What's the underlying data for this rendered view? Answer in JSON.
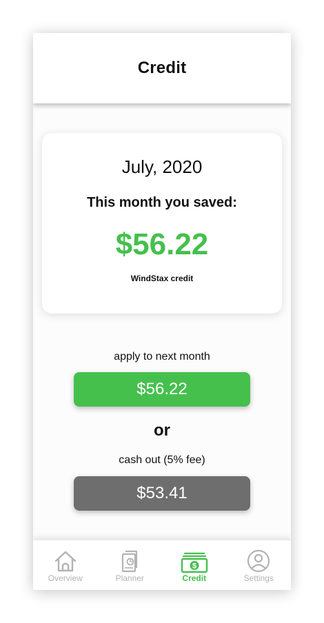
{
  "header": {
    "title": "Credit"
  },
  "summary": {
    "month": "July, 2020",
    "saved_label": "This month you saved:",
    "amount": "$56.22",
    "amount_caption": "WindStax credit"
  },
  "options": {
    "apply_label": "apply to next month",
    "apply_amount": "$56.22",
    "or_text": "or",
    "cash_label": "cash out (5% fee)",
    "cash_amount": "$53.41"
  },
  "tabs": [
    {
      "label": "Overview",
      "icon": "home-icon",
      "active": false
    },
    {
      "label": "Planner",
      "icon": "planner-icon",
      "active": false
    },
    {
      "label": "Credit",
      "icon": "cash-icon",
      "active": true
    },
    {
      "label": "Settings",
      "icon": "user-settings-icon",
      "active": false
    }
  ],
  "colors": {
    "accent_green": "#45c04d",
    "cash_button_gray": "#6e6e6e",
    "inactive_tab": "#b3b3b3"
  }
}
